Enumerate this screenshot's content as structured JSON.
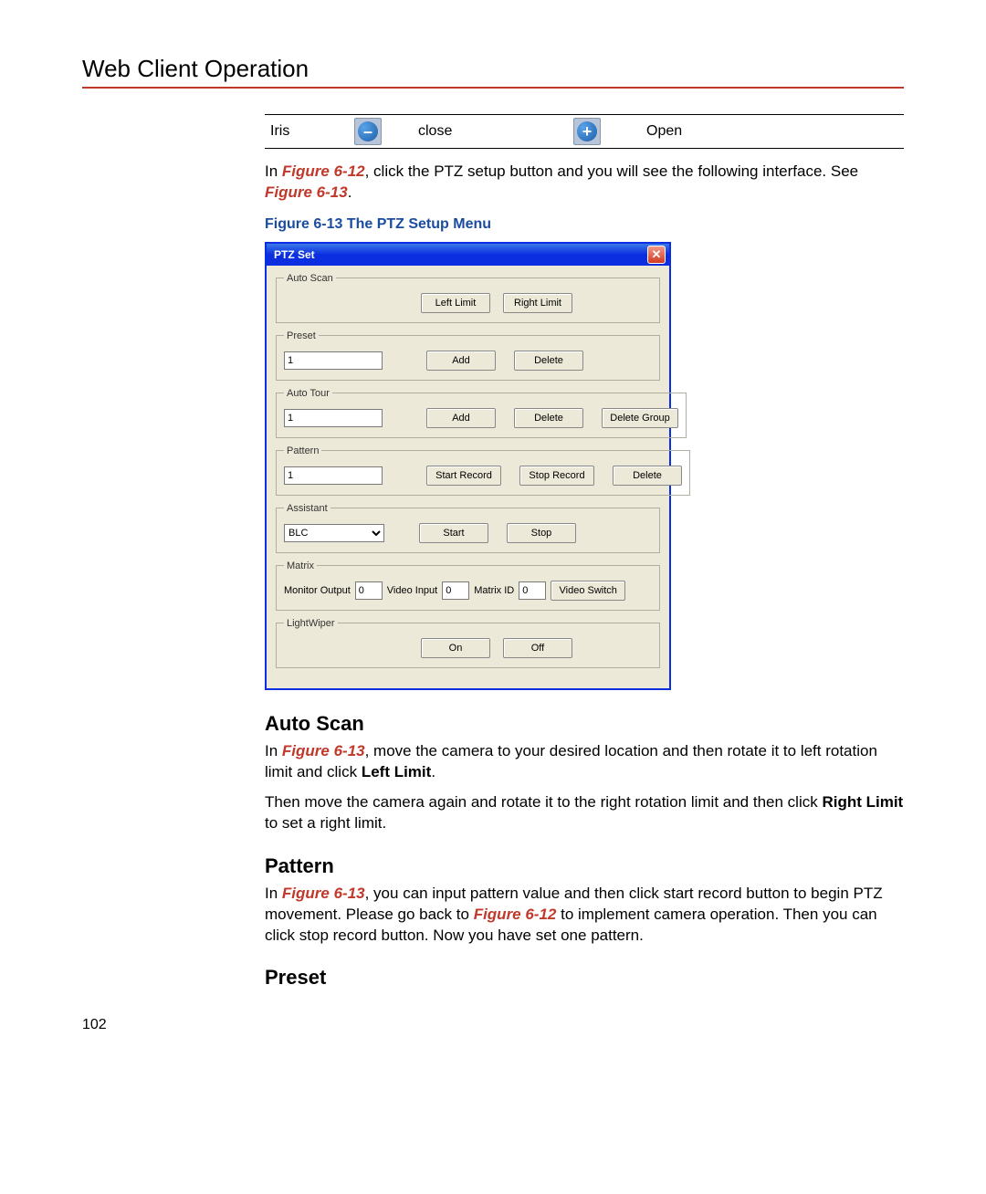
{
  "header": "Web Client Operation",
  "iris_row": {
    "label": "Iris",
    "close": "close",
    "open": "Open"
  },
  "intro_para": {
    "pre": "In ",
    "fig": "Figure 6-12",
    "post": ", click the PTZ setup button and you will see the following interface. See ",
    "fig2": "Figure 6-13",
    "end": "."
  },
  "figcaption": "Figure 6-13 The PTZ Setup Menu",
  "dialog": {
    "title": "PTZ Set",
    "autoscan": {
      "legend": "Auto Scan",
      "left": "Left Limit",
      "right": "Right Limit"
    },
    "preset": {
      "legend": "Preset",
      "val": "1",
      "add": "Add",
      "del": "Delete"
    },
    "autotour": {
      "legend": "Auto Tour",
      "val": "1",
      "add": "Add",
      "del": "Delete",
      "delgroup": "Delete Group"
    },
    "pattern": {
      "legend": "Pattern",
      "val": "1",
      "start": "Start Record",
      "stop": "Stop Record",
      "del": "Delete"
    },
    "assistant": {
      "legend": "Assistant",
      "option": "BLC",
      "start": "Start",
      "stop": "Stop"
    },
    "matrix": {
      "legend": "Matrix",
      "monout": "Monitor Output",
      "monout_v": "0",
      "vin": "Video Input",
      "vin_v": "0",
      "mid": "Matrix ID",
      "mid_v": "0",
      "vswitch": "Video Switch"
    },
    "light": {
      "legend": "LightWiper",
      "on": "On",
      "off": "Off"
    }
  },
  "section_autoscan": {
    "title": "Auto Scan",
    "p1_pre": "In ",
    "p1_fig": "Figure 6-13",
    "p1_post": ", move the camera to your desired location and then rotate it to left rotation limit and click ",
    "p1_bold": "Left Limit",
    "p1_end": ".",
    "p2_pre": "Then move the camera again and rotate it to the right rotation limit and then click ",
    "p2_bold": "Right Limit",
    "p2_post": " to set a right limit."
  },
  "section_pattern": {
    "title": "Pattern",
    "p_pre": "In ",
    "p_fig1": "Figure 6-13",
    "p_mid": ", you can input pattern value and then click start record button to begin PTZ movement. Please go back to ",
    "p_fig2": "Figure 6-12",
    "p_post": " to implement camera operation. Then you can click stop record button. Now you have set one pattern."
  },
  "section_preset": {
    "title": "Preset"
  },
  "pagenum": "102"
}
